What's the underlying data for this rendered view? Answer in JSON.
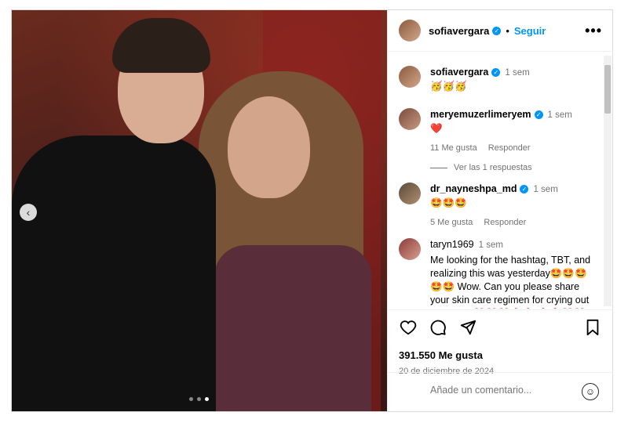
{
  "post": {
    "author": "sofiavergara",
    "follow_label": "Seguir",
    "separator": "•",
    "more_label": "•••"
  },
  "caption": {
    "author": "sofiavergara",
    "time": "1 sem",
    "text": "🥳🥳🥳"
  },
  "comments": [
    {
      "user": "meryemuzerlimeryem",
      "verified": true,
      "time": "1 sem",
      "text": "❤️",
      "likes": "11 Me gusta",
      "reply": "Responder"
    },
    {
      "user": "dr_nayneshpa_md",
      "verified": true,
      "time": "1 sem",
      "text": "🤩🤩🤩",
      "likes": "5 Me gusta",
      "reply": "Responder"
    },
    {
      "user": "taryn1969",
      "verified": false,
      "time": "1 sem",
      "text": "Me looking for the hashtag, TBT, and realizing this was yesterday🤩🤩🤩🤩🤩 Wow. Can you please share your skin care regimen for crying out loud?!?!? ❤️❤️❤️🔥🔥 🔥🔥❤️❤️"
    }
  ],
  "view_replies": "Ver las 1 respuestas",
  "likes_count": "391.550 Me gusta",
  "date": "20 de diciembre de 2024",
  "comment_placeholder": "Añade un comentario...",
  "carousel": {
    "dots": 3,
    "active": 2
  }
}
